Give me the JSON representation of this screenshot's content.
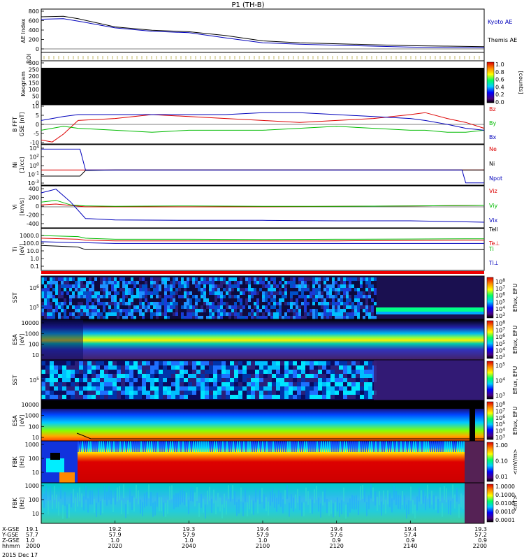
{
  "title": "P1 (TH-B)",
  "date_label": "2015 Dec 17",
  "chart_data": [
    {
      "type": "line",
      "panel": "ae",
      "ylabel": "AE Index",
      "ylim": [
        -50,
        850
      ],
      "yticks": [
        "800",
        "600",
        "400",
        "200",
        "0"
      ],
      "x": [
        0,
        6,
        10,
        20,
        30,
        40,
        50,
        60,
        70,
        80,
        90,
        100,
        110,
        120
      ],
      "series": [
        {
          "name": "Kyoto AE",
          "color": "#0000bb",
          "values": [
            640,
            650,
            600,
            460,
            390,
            360,
            250,
            150,
            120,
            100,
            80,
            60,
            50,
            45
          ]
        },
        {
          "name": "Themis AE",
          "color": "#000000",
          "values": [
            690,
            700,
            650,
            480,
            410,
            380,
            300,
            190,
            150,
            130,
            110,
            90,
            80,
            70
          ]
        }
      ]
    },
    {
      "type": "heatmap",
      "panel": "roi",
      "ylabel": "ROI"
    },
    {
      "type": "heatmap",
      "panel": "keogram",
      "ylabel": "Keogram",
      "yticks": [
        "300",
        "250",
        "200",
        "150",
        "100",
        "50",
        "0"
      ],
      "colorbar": {
        "ticks": [
          "1.0",
          "0.8",
          "0.6",
          "0.4",
          "0.2",
          "0.0"
        ],
        "label": "[counts]"
      }
    },
    {
      "type": "line",
      "panel": "bfield",
      "ylabel": "B FFT",
      "yunit": "GSE [nT]",
      "ylim": [
        -10,
        10
      ],
      "yticks": [
        "10",
        "5",
        "0",
        "-5",
        "-10"
      ],
      "x": [
        0,
        3,
        6,
        10,
        20,
        30,
        40,
        50,
        60,
        70,
        80,
        90,
        100,
        104,
        110,
        115,
        120
      ],
      "series": [
        {
          "name": "Bz",
          "color": "#dd0000",
          "values": [
            -8,
            -9,
            -5,
            2,
            3,
            5,
            4,
            3,
            2,
            1,
            2,
            3,
            5,
            6,
            3,
            1,
            -2
          ]
        },
        {
          "name": "By",
          "color": "#00bb00",
          "values": [
            -3,
            -2,
            -1,
            -2,
            -3,
            -4,
            -3,
            -3,
            -3,
            -2,
            -1,
            -2,
            -3,
            -3,
            -4,
            -4,
            -3
          ]
        },
        {
          "name": "Bx",
          "color": "#0000bb",
          "values": [
            2,
            3,
            4,
            5,
            5,
            5,
            5,
            5,
            6,
            6,
            5,
            4,
            3,
            2,
            0,
            -2,
            -3
          ]
        }
      ]
    },
    {
      "type": "line",
      "panel": "density",
      "ylabel": "Ni",
      "yunit": "[1/cc]",
      "yticks": [
        "10^4",
        "10^2",
        "10^0",
        "10^-1",
        "10^-3"
      ],
      "x": [
        0,
        10,
        10.5,
        12,
        20,
        40,
        60,
        80,
        100,
        114,
        115,
        116,
        120
      ],
      "series": [
        {
          "name": "Ne",
          "color": "#dd0000",
          "values": [
            0.3,
            0.3,
            0.3,
            0.3,
            0.3,
            0.3,
            0.3,
            0.3,
            0.3,
            0.3,
            0.3,
            0.3,
            0.3
          ]
        },
        {
          "name": "Ni",
          "color": "#000000",
          "values": [
            0.02,
            0.02,
            0.02,
            0.25,
            0.3,
            0.3,
            0.3,
            0.3,
            0.3,
            0.3,
            0.3,
            0.3,
            0.3
          ]
        },
        {
          "name": "Npot",
          "color": "#0000bb",
          "values": [
            3000,
            3000,
            3000,
            0.3,
            0.3,
            0.3,
            0.3,
            0.3,
            0.3,
            0.3,
            0.001,
            0.001,
            0.001
          ]
        }
      ]
    },
    {
      "type": "line",
      "panel": "velocity",
      "ylabel": "Vi",
      "yunit": "[km/s]",
      "ylim": [
        -450,
        450
      ],
      "yticks": [
        "400",
        "200",
        "0",
        "-200",
        "-400"
      ],
      "x": [
        0,
        4,
        8,
        12,
        20,
        40,
        60,
        80,
        100,
        120
      ],
      "series": [
        {
          "name": "Viz",
          "color": "#dd0000",
          "values": [
            40,
            60,
            30,
            0,
            0,
            0,
            0,
            10,
            20,
            30
          ]
        },
        {
          "name": "Viy",
          "color": "#00bb00",
          "values": [
            100,
            140,
            40,
            20,
            10,
            20,
            10,
            10,
            20,
            30
          ]
        },
        {
          "name": "Vix",
          "color": "#0000bb",
          "values": [
            300,
            380,
            100,
            -250,
            -280,
            -290,
            -290,
            -300,
            -300,
            -330
          ]
        }
      ]
    },
    {
      "type": "line",
      "panel": "temperature",
      "ylabel": "Ti",
      "yunit": "[eV]",
      "yticks": [
        "1000.0",
        "100.0",
        "10.0",
        "1.0",
        "0.1"
      ],
      "legend": [
        "Tell",
        "Te⊥",
        "Ti",
        "Ti⊥"
      ],
      "x": [
        0,
        10,
        12,
        20,
        40,
        60,
        80,
        100,
        115,
        120
      ],
      "series": [
        {
          "name": "Te⊥",
          "color": "#dd0000",
          "values": [
            200,
            150,
            120,
            100,
            100,
            100,
            100,
            110,
            120,
            120
          ]
        },
        {
          "name": "Ti",
          "color": "#00bb00",
          "values": [
            400,
            300,
            200,
            150,
            150,
            140,
            150,
            160,
            170,
            170
          ]
        },
        {
          "name": "Ti⊥",
          "color": "#0000bb",
          "values": [
            80,
            60,
            60,
            50,
            50,
            50,
            50,
            50,
            50,
            50
          ]
        },
        {
          "name": "Tell",
          "color": "#000000",
          "values": [
            30,
            20,
            10,
            10,
            10,
            10,
            10,
            10,
            10,
            10
          ]
        }
      ]
    },
    {
      "type": "heatmap",
      "panel": "sst_e",
      "ylabel": "SST",
      "yticks": [
        "10^6",
        "10^5"
      ],
      "colorbar": {
        "ticks": [
          "10^8",
          "10^7",
          "10^6",
          "10^5",
          "10^4",
          "10^3"
        ],
        "label": "Eflux, EFU"
      }
    },
    {
      "type": "heatmap",
      "panel": "esa_e",
      "ylabel": "ESA",
      "yunit": "[eV]",
      "yticks": [
        "10000",
        "1000",
        "100",
        "10"
      ],
      "colorbar": {
        "ticks": [
          "10^8",
          "10^7",
          "10^6",
          "10^5",
          "10^4",
          "10^3"
        ],
        "label": "Eflux, EFU"
      }
    },
    {
      "type": "heatmap",
      "panel": "sst_i",
      "ylabel": "SST",
      "yticks": [
        "10^5"
      ],
      "colorbar": {
        "ticks": [
          "10^5",
          "10^4",
          "10^3"
        ],
        "label": "Eflux, EFU"
      }
    },
    {
      "type": "heatmap",
      "panel": "esa_i",
      "ylabel": "ESA",
      "yunit": "[eV]",
      "yticks": [
        "10000",
        "1000",
        "100",
        "10"
      ],
      "colorbar": {
        "ticks": [
          "10^8",
          "10^7",
          "10^6",
          "10^5",
          "10^4",
          "10^3"
        ],
        "label": "Eflux, EFU"
      }
    },
    {
      "type": "heatmap",
      "panel": "fbk_e",
      "ylabel": "FBK",
      "yunit": "[Hz]",
      "yticks": [
        "1000",
        "100",
        "10"
      ],
      "colorbar": {
        "ticks": [
          "1.00",
          "0.10",
          "0.01"
        ],
        "label": "<mV/m>"
      }
    },
    {
      "type": "heatmap",
      "panel": "fbk_b",
      "ylabel": "FBK",
      "yunit": "[Hz]",
      "yticks": [
        "1000",
        "100",
        "10"
      ],
      "colorbar": {
        "ticks": [
          "1.0000",
          "0.1000",
          "0.0100",
          "0.0010",
          "0.0001"
        ],
        "label": "<nT>"
      }
    }
  ],
  "x_axis": {
    "row_labels": [
      "X-GSE",
      "Y-GSE",
      "Z-GSE",
      "hhmm"
    ],
    "columns": [
      {
        "x": "19.1",
        "y": "57.7",
        "z": "1.0",
        "t": "2000"
      },
      {
        "x": "19.2",
        "y": "57.9",
        "z": "1.0",
        "t": "2020"
      },
      {
        "x": "19.3",
        "y": "57.9",
        "z": "1.0",
        "t": "2040"
      },
      {
        "x": "19.4",
        "y": "57.9",
        "z": "1.0",
        "t": "2100"
      },
      {
        "x": "19.4",
        "y": "57.6",
        "z": "0.9",
        "t": "2120"
      },
      {
        "x": "19.4",
        "y": "57.4",
        "z": "0.9",
        "t": "2140"
      },
      {
        "x": "19.3",
        "y": "57.2",
        "z": "0.9",
        "t": "2200"
      }
    ]
  }
}
